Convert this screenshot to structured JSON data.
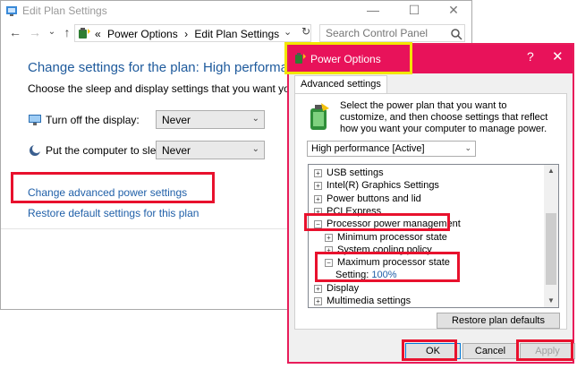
{
  "edit_window": {
    "title": "Edit Plan Settings",
    "caption_buttons": {
      "minimize": "—",
      "maximize": "☐",
      "close": "✕"
    },
    "address": {
      "prefix": "«",
      "crumbs": [
        "Power Options",
        "›",
        "Edit Plan Settings"
      ],
      "dropdown": "⌄",
      "refresh": "↻"
    },
    "search_placeholder": "Search Control Panel",
    "heading": "Change settings for the plan: High performance",
    "subtitle": "Choose the sleep and display settings that you want your computer to",
    "settings": [
      {
        "label": "Turn off the display:",
        "value": "Never"
      },
      {
        "label": "Put the computer to sleep:",
        "value": "Never"
      }
    ],
    "advanced_link": "Change advanced power settings",
    "restore_link": "Restore default settings for this plan"
  },
  "power_dialog": {
    "title": "Power Options",
    "help": "?",
    "close": "✕",
    "tab": "Advanced settings",
    "description": "Select the power plan that you want to customize, and then choose settings that reflect how you want your computer to manage power.",
    "plan_value": "High performance [Active]",
    "tree": [
      {
        "label": "USB settings",
        "exp": "+",
        "indent": 0
      },
      {
        "label": "Intel(R) Graphics Settings",
        "exp": "+",
        "indent": 0
      },
      {
        "label": "Power buttons and lid",
        "exp": "+",
        "indent": 0
      },
      {
        "label": "PCI Express",
        "exp": "+",
        "indent": 0
      },
      {
        "label": "Processor power management",
        "exp": "−",
        "indent": 0
      },
      {
        "label": "Minimum processor state",
        "exp": "+",
        "indent": 1
      },
      {
        "label": "System cooling policy",
        "exp": "+",
        "indent": 1
      },
      {
        "label": "Maximum processor state",
        "exp": "−",
        "indent": 1
      },
      {
        "label": "Setting:",
        "value": "100%",
        "indent": 2
      },
      {
        "label": "Display",
        "exp": "+",
        "indent": 0
      },
      {
        "label": "Multimedia settings",
        "exp": "+",
        "indent": 0
      }
    ],
    "restore_button": "Restore plan defaults",
    "ok": "OK",
    "cancel": "Cancel",
    "apply": "Apply"
  },
  "colors": {
    "accent_titlebar": "#e8125a",
    "highlight_box": "#e8112d",
    "title_highlight": "#f2e600",
    "link": "#1f5fa8"
  }
}
